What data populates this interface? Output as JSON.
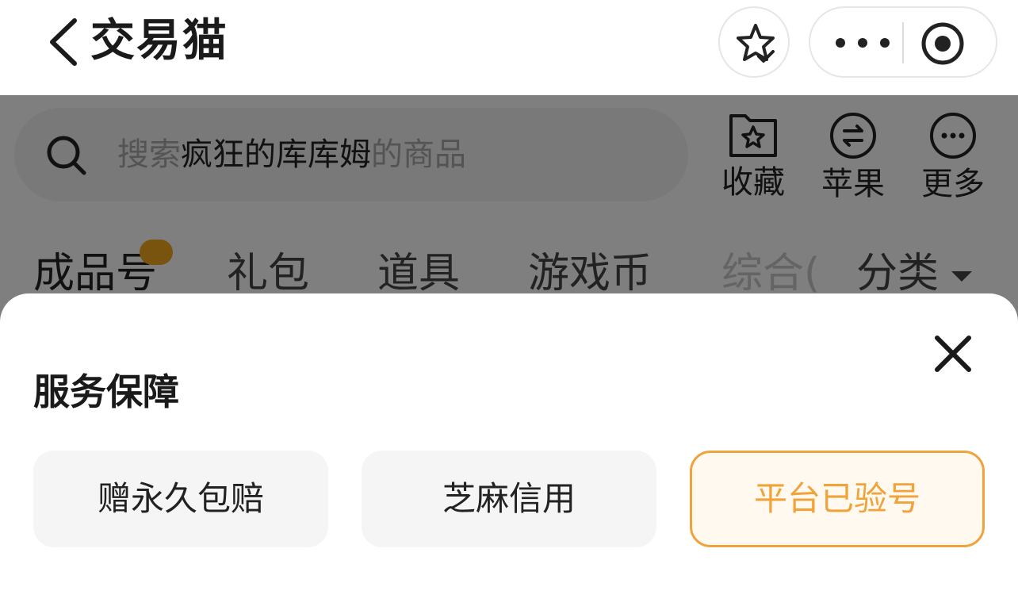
{
  "header": {
    "title": "交易猫",
    "back_icon": "chevron-left-icon",
    "favorite_icon": "star-check-icon",
    "more_icon": "ellipsis-icon",
    "close_capsule_icon": "target-circle-icon"
  },
  "search": {
    "prefix": "搜索",
    "keyword": "疯狂的库库姆",
    "suffix": "的商品",
    "icon": "search-icon"
  },
  "tools": [
    {
      "label": "收藏",
      "icon": "folder-star-icon"
    },
    {
      "label": "苹果",
      "icon": "swap-circle-icon"
    },
    {
      "label": "更多",
      "icon": "more-circle-icon"
    }
  ],
  "tabs": [
    {
      "label": "成品号"
    },
    {
      "label": "礼包"
    },
    {
      "label": "道具"
    },
    {
      "label": "游戏币"
    },
    {
      "label": "综合(",
      "faded": true
    },
    {
      "label": "分类"
    }
  ],
  "sheet": {
    "title": "服务保障",
    "options": [
      {
        "label": "赠永久包赔",
        "selected": false
      },
      {
        "label": "芝麻信用",
        "selected": false
      },
      {
        "label": "平台已验号",
        "selected": true
      }
    ],
    "close_icon": "close-icon"
  },
  "colors": {
    "accent": "#f0a33a",
    "overlay": "rgba(0,0,0,0.5)",
    "badge": "#f0a91e"
  }
}
